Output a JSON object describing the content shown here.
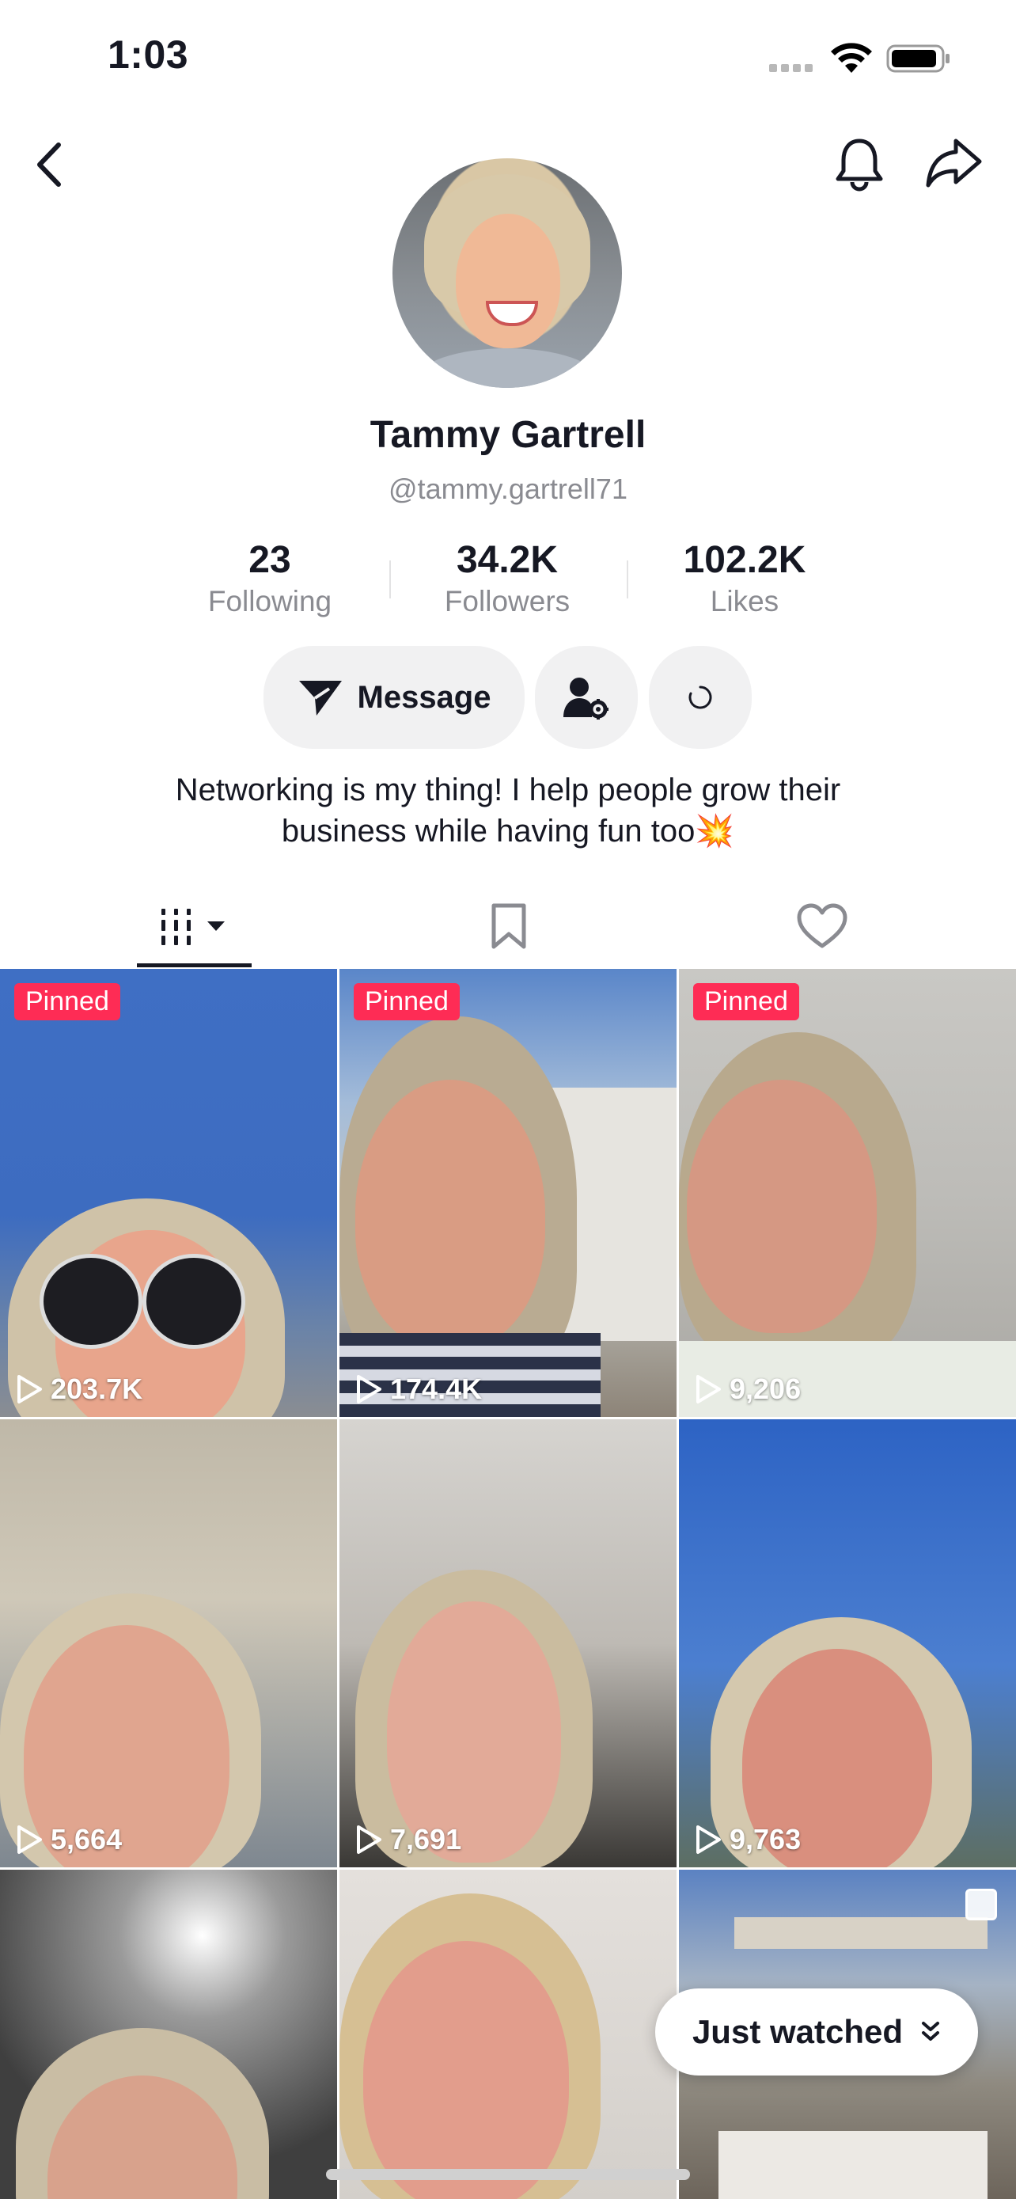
{
  "status_bar": {
    "time": "1:03"
  },
  "profile": {
    "name": "Tammy Gartrell",
    "handle": "@tammy.gartrell71",
    "stats": [
      {
        "value": "23",
        "label": "Following"
      },
      {
        "value": "34.2K",
        "label": "Followers"
      },
      {
        "value": "102.2K",
        "label": "Likes"
      }
    ],
    "message_label": "Message",
    "bio": "Networking is my thing! I help people grow their business while having fun too💥"
  },
  "videos": [
    {
      "pinned": "Pinned",
      "views": "203.7K"
    },
    {
      "pinned": "Pinned",
      "views": "174.4K"
    },
    {
      "pinned": "Pinned",
      "views": "9,206"
    },
    {
      "views": "5,664"
    },
    {
      "views": "7,691"
    },
    {
      "views": "9,763"
    }
  ],
  "just_watched": "Just watched",
  "colors": {
    "accent": "#fe2c55",
    "text": "#161823",
    "muted": "#8a8b91"
  },
  "icons": [
    "back-icon",
    "bell-icon",
    "share-icon",
    "send-icon",
    "user-settings-icon",
    "loading-icon",
    "videos-tab-icon",
    "bookmark-icon",
    "heart-icon",
    "play-icon",
    "chevron-double-down-icon"
  ]
}
